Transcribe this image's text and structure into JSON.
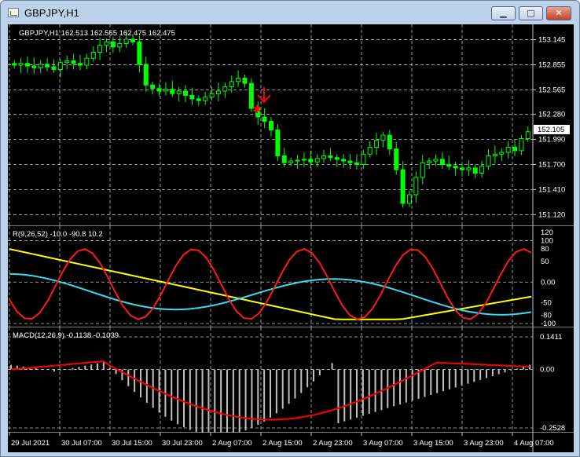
{
  "window": {
    "title": "GBPJPY,H1",
    "buttons": {
      "minimize": "▁",
      "maximize": "□",
      "close": "✕"
    }
  },
  "price_pane": {
    "header": "GBPJPY,H1  162.513 162.565 162.475 162.475",
    "price_labels": [
      "153.145",
      "152.855",
      "152.565",
      "152.280",
      "151.990",
      "151.700",
      "151.410",
      "151.120"
    ],
    "current_price": "152.105",
    "marker_color": "#ff0000"
  },
  "rsi_pane": {
    "header": "R(9,26,52) -10.0 -90.8 10.2",
    "levels": [
      "120",
      "100",
      "80",
      "50",
      "0.00",
      "-50",
      "-80",
      "-100"
    ]
  },
  "macd_pane": {
    "header": "MACD(12,26,9) -0.1138 -0.1039",
    "levels": [
      "0.1411",
      "0.00",
      "-0.2528"
    ]
  },
  "time_labels": [
    "29 Jul 2021",
    "30 Jul 07:00",
    "30 Jul 15:00",
    "30 Jul 23:00",
    "2 Aug 07:00",
    "2 Aug 15:00",
    "2 Aug 23:00",
    "3 Aug 07:00",
    "3 Aug 15:00",
    "3 Aug 23:00",
    "4 Aug 07:00"
  ],
  "colors": {
    "background": "#000000",
    "grid": "#c0c0c0",
    "bull_candle": "#ffffff",
    "bear_candle": "#00ff00",
    "rsi_red": "#ff1a1a",
    "rsi_cyan": "#33ddee",
    "rsi_yellow": "#ffff00",
    "macd_hist": "#c0c0c0",
    "macd_signal": "#ff0000"
  },
  "chart_data": {
    "type": "candlestick",
    "ylim": [
      151.05,
      153.25
    ],
    "close_series": [
      152.85,
      152.87,
      152.84,
      152.82,
      152.86,
      152.83,
      152.8,
      152.88,
      152.9,
      152.87,
      152.85,
      152.93,
      153.0,
      153.08,
      153.12,
      153.06,
      153.1,
      153.15,
      153.12,
      152.86,
      152.62,
      152.58,
      152.55,
      152.57,
      152.52,
      152.55,
      152.5,
      152.46,
      152.44,
      152.48,
      152.52,
      152.55,
      152.6,
      152.66,
      152.7,
      152.64,
      152.35,
      152.25,
      152.2,
      152.1,
      151.8,
      151.72,
      151.74,
      151.75,
      151.76,
      151.73,
      151.77,
      151.8,
      151.78,
      151.76,
      151.74,
      151.72,
      151.7,
      151.82,
      151.9,
      151.98,
      152.04,
      151.88,
      151.64,
      151.25,
      151.35,
      151.55,
      151.72,
      151.74,
      151.76,
      151.7,
      151.68,
      151.66,
      151.64,
      151.66,
      151.6,
      151.68,
      151.8,
      151.82,
      151.84,
      151.9,
      151.86,
      152.0,
      152.08
    ]
  }
}
